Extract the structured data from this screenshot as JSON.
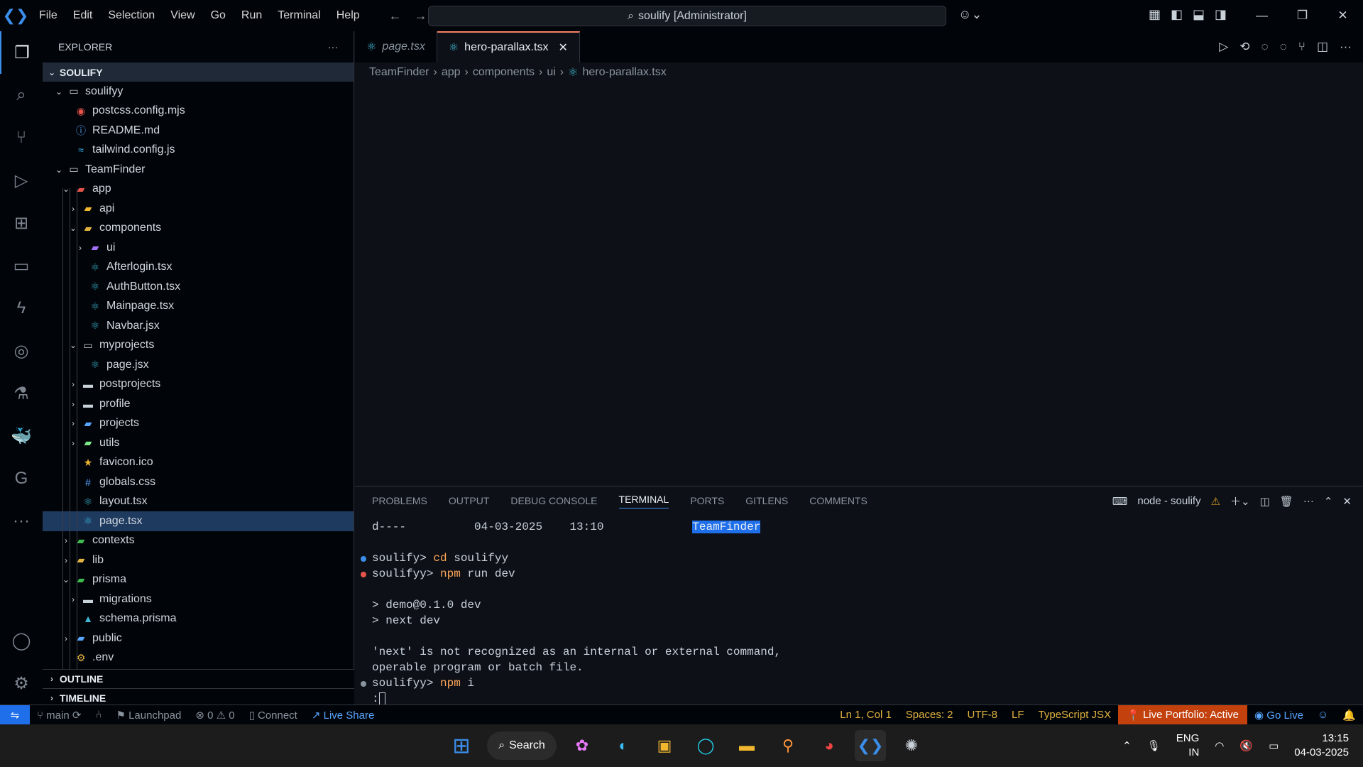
{
  "titlebar": {
    "menu": [
      "File",
      "Edit",
      "Selection",
      "View",
      "Go",
      "Run",
      "Terminal",
      "Help"
    ],
    "command_center": "soulify [Administrator]"
  },
  "sidebar": {
    "title": "EXPLORER",
    "root": "SOULIFY",
    "outline": "OUTLINE",
    "timeline": "TIMELINE",
    "items": [
      {
        "label": "soulifyy",
        "indent": 1,
        "chev": "v",
        "icon": "folder-open-icon",
        "color": "#c9d1d9"
      },
      {
        "label": "postcss.config.mjs",
        "indent": 2,
        "chev": "",
        "icon": "postcss-icon",
        "color": "#e5534b"
      },
      {
        "label": "README.md",
        "indent": 2,
        "chev": "",
        "icon": "info-icon",
        "color": "#58a6ff"
      },
      {
        "label": "tailwind.config.js",
        "indent": 2,
        "chev": "",
        "icon": "tailwind-icon",
        "color": "#38bdf8"
      },
      {
        "label": "TeamFinder",
        "indent": 1,
        "chev": "v",
        "icon": "folder-open-icon",
        "color": "#c9d1d9"
      },
      {
        "label": "app",
        "indent": 2,
        "chev": "v",
        "icon": "app-folder-icon",
        "color": "#e5534b"
      },
      {
        "label": "api",
        "indent": 3,
        "chev": ">",
        "icon": "api-folder-icon",
        "color": "#f0b72f"
      },
      {
        "label": "components",
        "indent": 3,
        "chev": "v",
        "icon": "components-folder-icon",
        "color": "#e3b341"
      },
      {
        "label": "ui",
        "indent": 4,
        "chev": ">",
        "icon": "ui-folder-icon",
        "color": "#a371f7"
      },
      {
        "label": "Afterlogin.tsx",
        "indent": 4,
        "chev": "",
        "icon": "react-icon",
        "color": "#3fb9d6"
      },
      {
        "label": "AuthButton.tsx",
        "indent": 4,
        "chev": "",
        "icon": "react-icon",
        "color": "#3fb9d6"
      },
      {
        "label": "Mainpage.tsx",
        "indent": 4,
        "chev": "",
        "icon": "react-icon",
        "color": "#3fb9d6"
      },
      {
        "label": "Navbar.jsx",
        "indent": 4,
        "chev": "",
        "icon": "react-icon",
        "color": "#3fb9d6"
      },
      {
        "label": "myprojects",
        "indent": 3,
        "chev": "v",
        "icon": "folder-open-icon",
        "color": "#c9d1d9"
      },
      {
        "label": "page.jsx",
        "indent": 4,
        "chev": "",
        "icon": "react-icon",
        "color": "#3fb9d6"
      },
      {
        "label": "postprojects",
        "indent": 3,
        "chev": ">",
        "icon": "folder-icon",
        "color": "#c9d1d9"
      },
      {
        "label": "profile",
        "indent": 3,
        "chev": ">",
        "icon": "folder-icon",
        "color": "#c9d1d9"
      },
      {
        "label": "projects",
        "indent": 3,
        "chev": ">",
        "icon": "projects-folder-icon",
        "color": "#58a6ff"
      },
      {
        "label": "utils",
        "indent": 3,
        "chev": ">",
        "icon": "utils-folder-icon",
        "color": "#7ee787"
      },
      {
        "label": "favicon.ico",
        "indent": 3,
        "chev": "",
        "icon": "star-icon",
        "color": "#f0b72f"
      },
      {
        "label": "globals.css",
        "indent": 3,
        "chev": "",
        "icon": "css-icon",
        "color": "#58a6ff"
      },
      {
        "label": "layout.tsx",
        "indent": 3,
        "chev": "",
        "icon": "react-icon",
        "color": "#3fb9d6"
      },
      {
        "label": "page.tsx",
        "indent": 3,
        "chev": "",
        "icon": "react-icon",
        "color": "#3fb9d6",
        "selected": true
      },
      {
        "label": "contexts",
        "indent": 2,
        "chev": ">",
        "icon": "contexts-folder-icon",
        "color": "#3fb950"
      },
      {
        "label": "lib",
        "indent": 2,
        "chev": ">",
        "icon": "lib-folder-icon",
        "color": "#e3b341"
      },
      {
        "label": "prisma",
        "indent": 2,
        "chev": "v",
        "icon": "prisma-folder-icon",
        "color": "#3fb950"
      },
      {
        "label": "migrations",
        "indent": 3,
        "chev": ">",
        "icon": "folder-icon",
        "color": "#c9d1d9"
      },
      {
        "label": "schema.prisma",
        "indent": 3,
        "chev": "",
        "icon": "prisma-icon",
        "color": "#3fb9d6"
      },
      {
        "label": "public",
        "indent": 2,
        "chev": ">",
        "icon": "public-folder-icon",
        "color": "#58a6ff"
      },
      {
        "label": ".env",
        "indent": 2,
        "chev": "",
        "icon": "env-icon",
        "color": "#e3b341"
      }
    ]
  },
  "editor": {
    "tabs": [
      {
        "label": "page.tsx",
        "active": false
      },
      {
        "label": "hero-parallax.tsx",
        "active": true
      }
    ],
    "breadcrumb": [
      "TeamFinder",
      "app",
      "components",
      "ui",
      "hero-parallax.tsx"
    ]
  },
  "panel": {
    "tabs": [
      "PROBLEMS",
      "OUTPUT",
      "DEBUG CONSOLE",
      "TERMINAL",
      "PORTS",
      "GITLENS",
      "COMMENTS"
    ],
    "active": "TERMINAL",
    "terminal_name": "node - soulify",
    "lines": [
      {
        "pre": "d----          04-03-2025    13:10             ",
        "hl": "TeamFinder"
      },
      {
        "text": ""
      },
      {
        "dot": "#3b8eea",
        "prompt": "soulify> ",
        "cmd": "cd",
        "rest": " soulifyy"
      },
      {
        "dot": "#e5534b",
        "prompt": "soulifyy> ",
        "cmd": "npm",
        "rest": " run dev"
      },
      {
        "text": ""
      },
      {
        "text": "> demo@0.1.0 dev"
      },
      {
        "text": "> next dev"
      },
      {
        "text": ""
      },
      {
        "text": "'next' is not recognized as an internal or external command,"
      },
      {
        "text": "operable program or batch file."
      },
      {
        "dot": "#8b949e",
        "prompt": "soulifyy> ",
        "cmd": "npm",
        "rest": " i"
      },
      {
        "text": ":"
      }
    ]
  },
  "statusbar": {
    "branch": "main",
    "launchpad": "Launchpad",
    "problems": "0",
    "warnings": "0",
    "connect": "Connect",
    "liveshare": "Live Share",
    "position": "Ln 1, Col 1",
    "spaces": "Spaces: 2",
    "encoding": "UTF-8",
    "eol": "LF",
    "language": "TypeScript JSX",
    "portfolio": "Live Portfolio: Active",
    "golive": "Go Live"
  },
  "taskbar": {
    "search": "Search",
    "lang1": "ENG",
    "lang2": "IN",
    "time": "13:15",
    "date": "04-03-2025"
  }
}
